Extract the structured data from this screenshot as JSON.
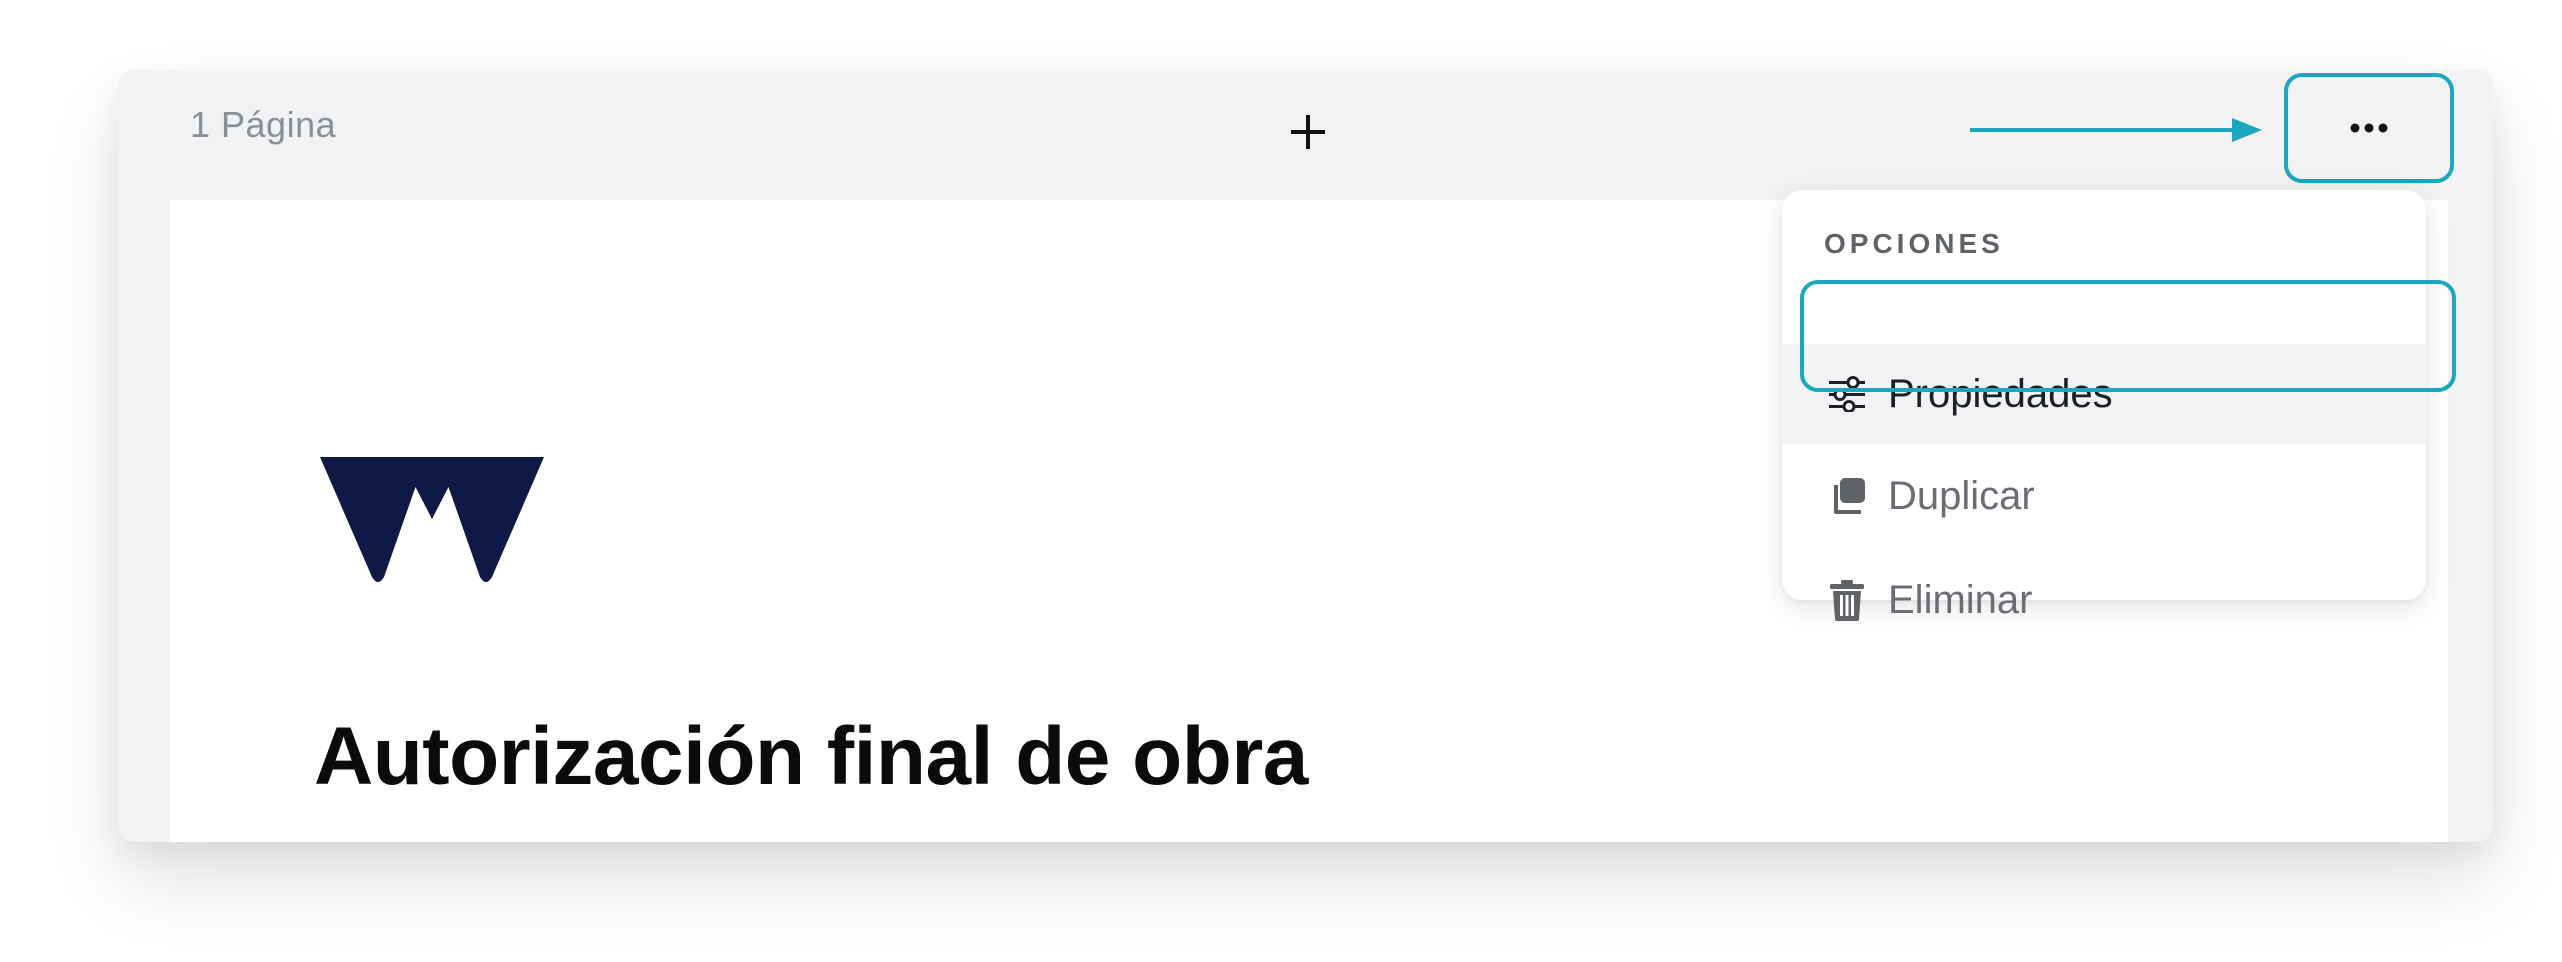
{
  "toolbar": {
    "page_count_label": "1 Página",
    "add_page_glyph": "+",
    "more_options_glyph": "•••"
  },
  "document": {
    "title": "Autorización final de obra"
  },
  "options_menu": {
    "header": "OPCIONES",
    "items": [
      {
        "label": "Propiedades",
        "icon": "sliders-icon",
        "highlighted": true
      },
      {
        "label": "Duplicar",
        "icon": "duplicate-icon",
        "highlighted": false
      },
      {
        "label": "Eliminar",
        "icon": "trash-icon",
        "highlighted": false
      }
    ]
  },
  "colors": {
    "accent": "#1aa7bf",
    "logo": "#0e1a45",
    "panel_bg": "#f1f2f4"
  }
}
